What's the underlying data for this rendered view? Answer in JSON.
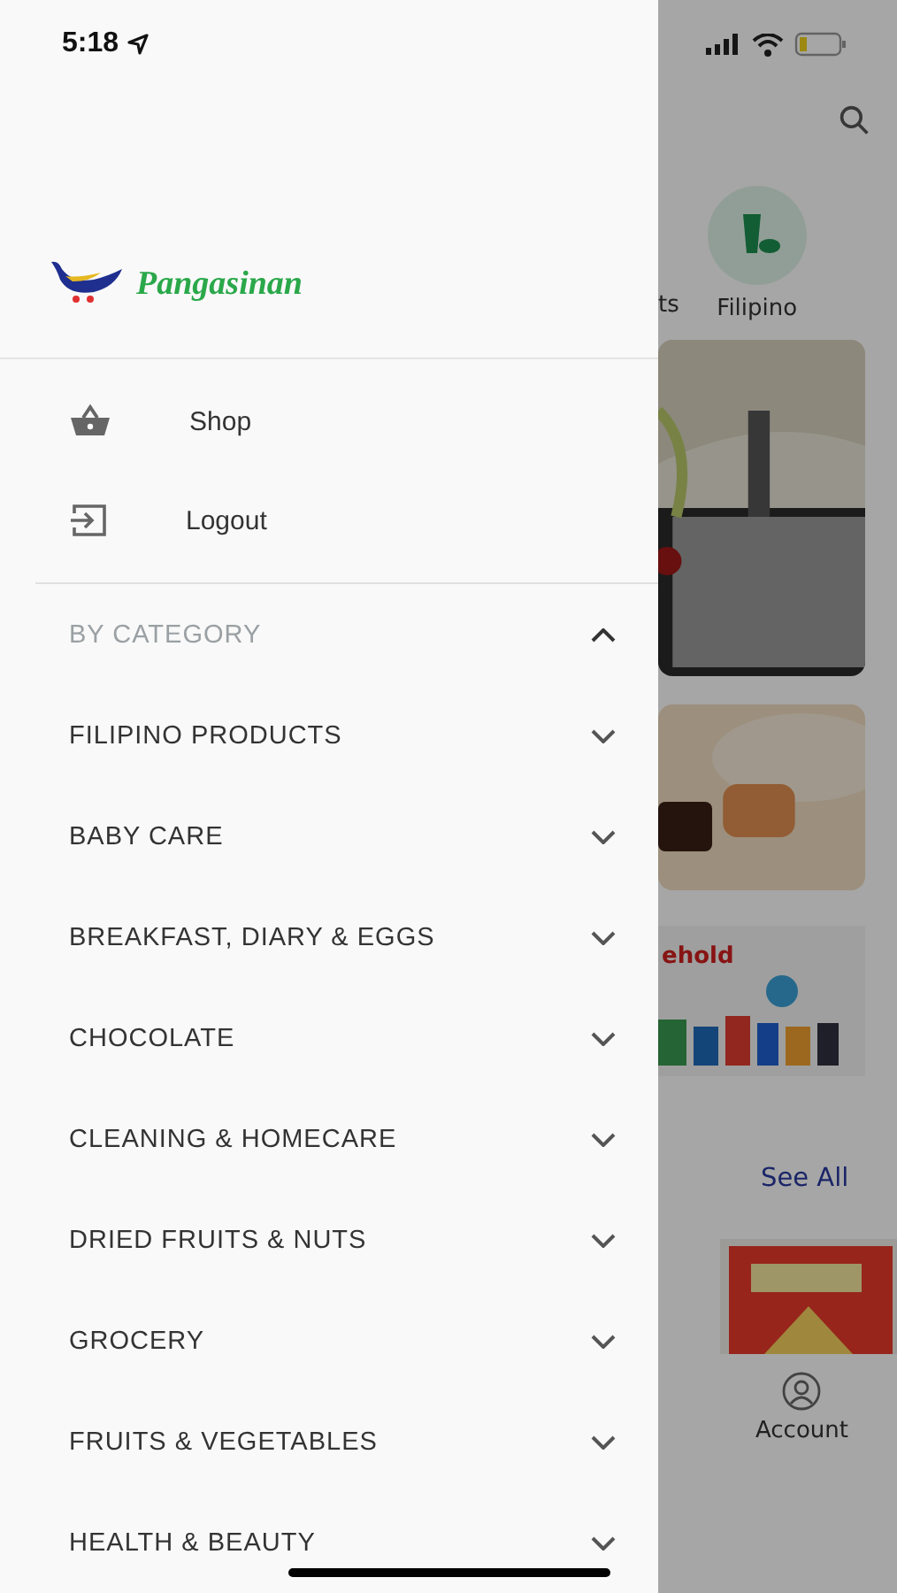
{
  "status_bar": {
    "time": "5:18"
  },
  "drawer": {
    "brand": "Pangasinan",
    "menu": [
      {
        "label": "Shop",
        "kind": "shop"
      },
      {
        "label": "Logout",
        "kind": "logout"
      }
    ],
    "category_header": {
      "label": "BY CATEGORY",
      "expanded": true
    },
    "categories": [
      {
        "label": "FILIPINO PRODUCTS",
        "expanded": false
      },
      {
        "label": "BABY CARE",
        "expanded": false
      },
      {
        "label": "BREAKFAST, DIARY & EGGS",
        "expanded": false
      },
      {
        "label": "CHOCOLATE",
        "expanded": false
      },
      {
        "label": "CLEANING & HOMECARE",
        "expanded": false
      },
      {
        "label": "DRIED FRUITS & NUTS",
        "expanded": false
      },
      {
        "label": "GROCERY",
        "expanded": false
      },
      {
        "label": "FRUITS & VEGETABLES",
        "expanded": false
      },
      {
        "label": "HEALTH & BEAUTY",
        "expanded": false
      }
    ]
  },
  "background": {
    "category_tabs": [
      "ts",
      "Filipino"
    ],
    "banner_text": "ehold",
    "see_all": "See All",
    "nav_item": "Account"
  }
}
